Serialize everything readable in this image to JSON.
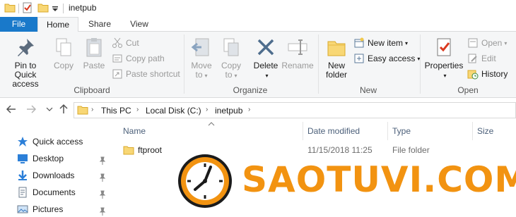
{
  "window": {
    "title": "inetpub"
  },
  "tabs": [
    {
      "label": "File"
    },
    {
      "label": "Home"
    },
    {
      "label": "Share"
    },
    {
      "label": "View"
    }
  ],
  "ribbon": {
    "clipboard": {
      "group_label": "Clipboard",
      "pin_label_1": "Pin to Quick",
      "pin_label_2": "access",
      "copy": "Copy",
      "paste": "Paste",
      "cut": "Cut",
      "copy_path": "Copy path",
      "paste_shortcut": "Paste shortcut"
    },
    "organize": {
      "group_label": "Organize",
      "move_to_1": "Move",
      "move_to_2": "to",
      "copy_to_1": "Copy",
      "copy_to_2": "to",
      "delete": "Delete",
      "rename": "Rename"
    },
    "new": {
      "group_label": "New",
      "new_folder_1": "New",
      "new_folder_2": "folder",
      "new_item": "New item",
      "easy_access": "Easy access"
    },
    "open": {
      "group_label": "Open",
      "properties": "Properties",
      "open": "Open",
      "edit": "Edit",
      "history": "History"
    }
  },
  "address": {
    "crumbs": [
      "This PC",
      "Local Disk (C:)",
      "inetpub"
    ]
  },
  "navpane": {
    "items": [
      {
        "label": "Quick access",
        "icon": "star-icon"
      },
      {
        "label": "Desktop",
        "icon": "desktop-icon"
      },
      {
        "label": "Downloads",
        "icon": "download-icon"
      },
      {
        "label": "Documents",
        "icon": "documents-icon"
      },
      {
        "label": "Pictures",
        "icon": "pictures-icon"
      }
    ]
  },
  "filelist": {
    "columns": [
      "Name",
      "Date modified",
      "Type",
      "Size"
    ],
    "rows": [
      {
        "name": "ftproot",
        "date": "11/15/2018 11:25",
        "type": "File folder",
        "size": ""
      }
    ]
  },
  "watermark": {
    "text": "SAOTUVI.COM"
  },
  "colors": {
    "accent": "#1979ca",
    "ribbon_bg": "#f5f6f7",
    "folder": "#f8d775",
    "watermark": "#f29311"
  }
}
